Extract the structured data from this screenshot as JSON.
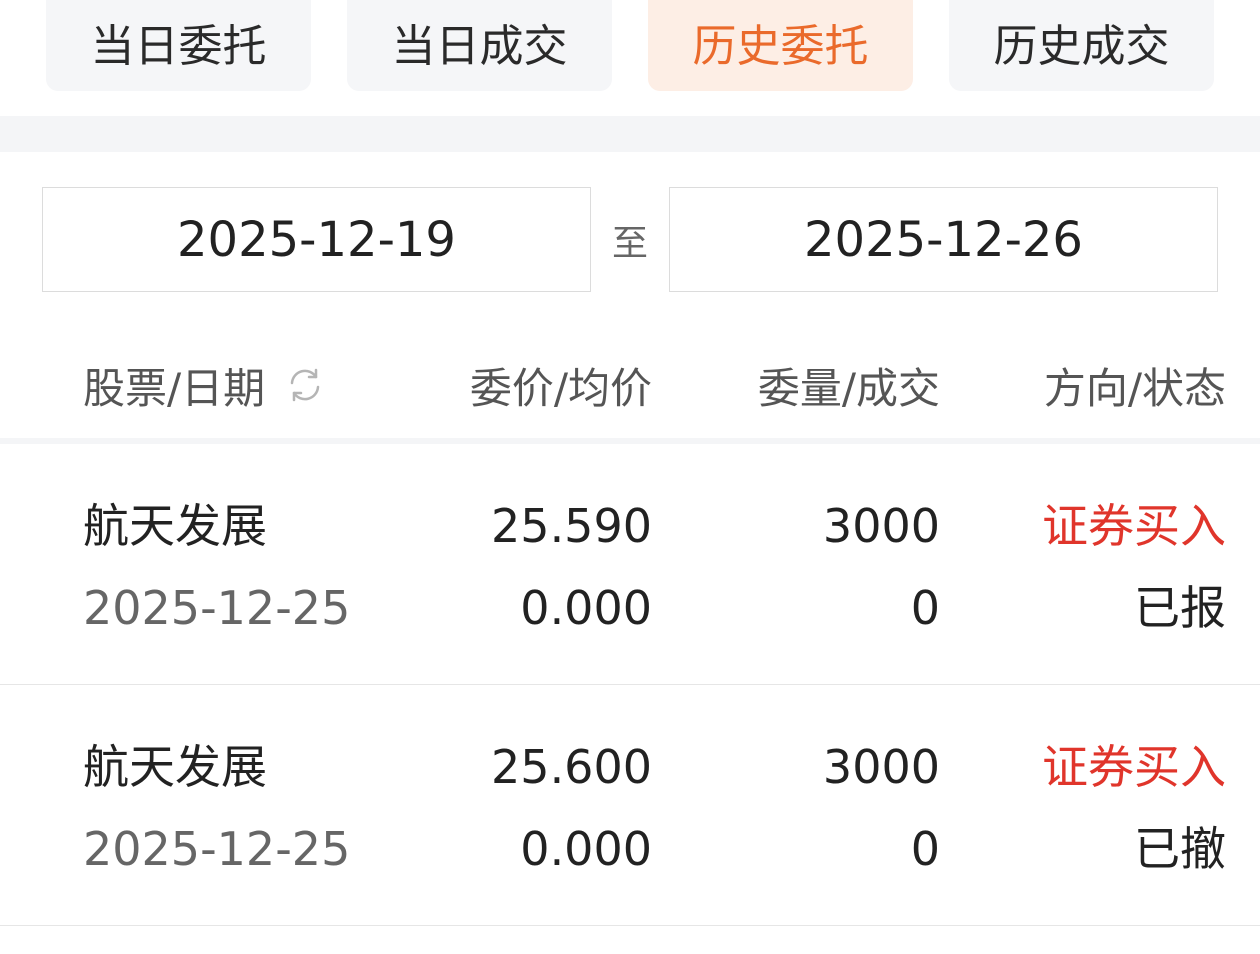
{
  "tabs": [
    {
      "label": "当日委托",
      "active": false
    },
    {
      "label": "当日成交",
      "active": false
    },
    {
      "label": "历史委托",
      "active": true
    },
    {
      "label": "历史成交",
      "active": false
    }
  ],
  "date_range": {
    "start": "2025-12-19",
    "separator": "至",
    "end": "2025-12-26"
  },
  "columns": {
    "stock_date": "股票/日期",
    "price": "委价/均价",
    "quantity": "委量/成交",
    "direction_status": "方向/状态"
  },
  "icons": {
    "refresh": "refresh-icon"
  },
  "colors": {
    "accent": "#ea6a2b",
    "active_tab_bg": "#fdeee5",
    "buy": "#e0352b"
  },
  "orders": [
    {
      "stock": "航天发展",
      "date": "2025-12-25",
      "order_price": "25.590",
      "avg_price": "0.000",
      "order_qty": "3000",
      "filled_qty": "0",
      "direction": "证券买入",
      "status": "已报"
    },
    {
      "stock": "航天发展",
      "date": "2025-12-25",
      "order_price": "25.600",
      "avg_price": "0.000",
      "order_qty": "3000",
      "filled_qty": "0",
      "direction": "证券买入",
      "status": "已撤"
    }
  ]
}
